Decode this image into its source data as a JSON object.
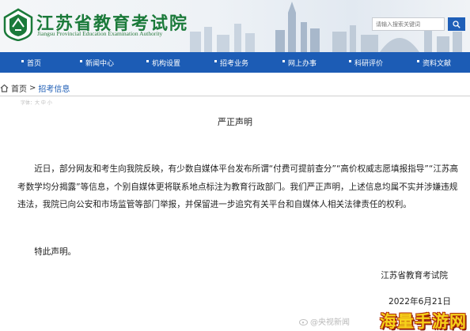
{
  "header": {
    "title": "江苏省教育考试院",
    "subtitle": "Jiangsu Provincial Education Examination Authority",
    "search_placeholder": "请输入搜索关键词"
  },
  "nav": {
    "items": [
      {
        "label": "首页"
      },
      {
        "label": "新闻中心"
      },
      {
        "label": "机构设置"
      },
      {
        "label": "招考业务"
      },
      {
        "label": "网上办事"
      },
      {
        "label": "科研评价"
      },
      {
        "label": "资料文献"
      }
    ]
  },
  "breadcrumb": {
    "home": "首页",
    "separator": ">",
    "current": "招考信息"
  },
  "font_size_control": "字体：大 中 小",
  "article": {
    "title": "严正声明",
    "paragraphs": [
      "近日，部分网友和考生向我院反映，有少数自媒体平台发布所谓“付费可提前查分”“高价权威志愿填报指导”“江苏高考数学均分揭露”等信息，个别自媒体更将联系地点标注为教育行政部门。我们严正声明，上述信息均属不实并涉嫌违规违法，我院已向公安和市场监管等部门举报，并保留进一步追究有关平台和自媒体人相关法律责任的权利。",
      "特此声明。"
    ],
    "signature_org": "江苏省教育考试院",
    "signature_date": "2022年6月21日"
  },
  "watermarks": {
    "weibo": "@央视新闻",
    "brand": "海量手游网"
  },
  "colors": {
    "nav_bg": "#1c5cb5",
    "title_green": "#1b7a3a",
    "brand_yellow": "#f6d21a"
  },
  "icons": [
    "school-emblem-icon",
    "search-icon",
    "home-icon",
    "weibo-icon"
  ]
}
